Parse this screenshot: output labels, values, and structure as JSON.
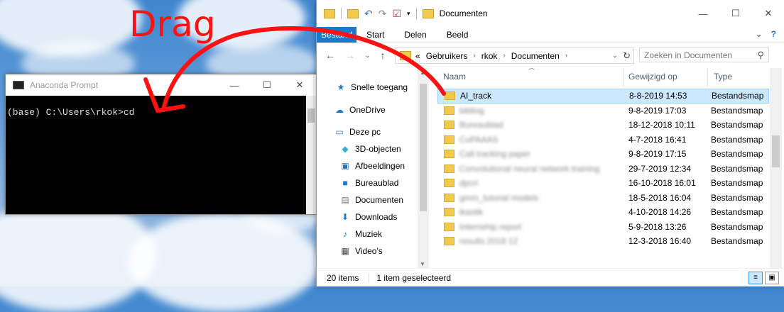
{
  "annotation": {
    "label": "Drag",
    "color": "#ff1111"
  },
  "prompt": {
    "title": "Anaconda Prompt",
    "line": "(base) C:\\Users\\rkok>cd"
  },
  "explorer": {
    "title": "Documenten",
    "accent": "#1979ca",
    "ribbon": {
      "file_tab": "Bestand",
      "tabs": [
        "Start",
        "Delen",
        "Beeld"
      ]
    },
    "address": {
      "prefix": "«",
      "crumbs": [
        "Gebruikers",
        "rkok",
        "Documenten"
      ]
    },
    "search": {
      "placeholder": "Zoeken in Documenten"
    },
    "nav_pane": [
      {
        "label": "Snelle toegang",
        "icon": "star-icon"
      },
      {
        "label": "OneDrive",
        "icon": "cloud-icon"
      },
      {
        "label": "Deze pc",
        "icon": "computer-icon"
      },
      {
        "label": "3D-objecten",
        "icon": "cube-icon"
      },
      {
        "label": "Afbeeldingen",
        "icon": "pictures-icon"
      },
      {
        "label": "Bureaublad",
        "icon": "desktop-icon"
      },
      {
        "label": "Documenten",
        "icon": "document-icon"
      },
      {
        "label": "Downloads",
        "icon": "download-icon"
      },
      {
        "label": "Muziek",
        "icon": "music-icon"
      },
      {
        "label": "Video's",
        "icon": "video-icon"
      }
    ],
    "columns": {
      "name": "Naam",
      "date": "Gewijzigd op",
      "type": "Type"
    },
    "files": [
      {
        "name": "AI_track",
        "date": "8-8-2019 14:53",
        "type": "Bestandsmap",
        "selected": true,
        "blurred": false
      },
      {
        "name": "bibliog",
        "date": "9-8-2019 17:03",
        "type": "Bestandsmap",
        "blurred": true
      },
      {
        "name": "Bureaublad",
        "date": "18-12-2018 10:11",
        "type": "Bestandsmap",
        "blurred": true
      },
      {
        "name": "CoPAAAS",
        "date": "4-7-2018 16:41",
        "type": "Bestandsmap",
        "blurred": true
      },
      {
        "name": "Call tracking paper",
        "date": "9-8-2019 17:15",
        "type": "Bestandsmap",
        "blurred": true
      },
      {
        "name": "Convolutional neural network training",
        "date": "29-7-2019 12:34",
        "type": "Bestandsmap",
        "blurred": true
      },
      {
        "name": "dpcri",
        "date": "16-10-2018 16:01",
        "type": "Bestandsmap",
        "blurred": true
      },
      {
        "name": "gmm_tutorial models",
        "date": "18-5-2018 16:04",
        "type": "Bestandsmap",
        "blurred": true
      },
      {
        "name": "ikastik",
        "date": "4-10-2018 14:26",
        "type": "Bestandsmap",
        "blurred": true
      },
      {
        "name": "Internship report",
        "date": "5-9-2018 13:26",
        "type": "Bestandsmap",
        "blurred": true
      },
      {
        "name": "results 2018 12",
        "date": "12-3-2018 16:40",
        "type": "Bestandsmap",
        "blurred": true
      }
    ],
    "status": {
      "count": "20 items",
      "selection": "1 item geselecteerd"
    }
  }
}
